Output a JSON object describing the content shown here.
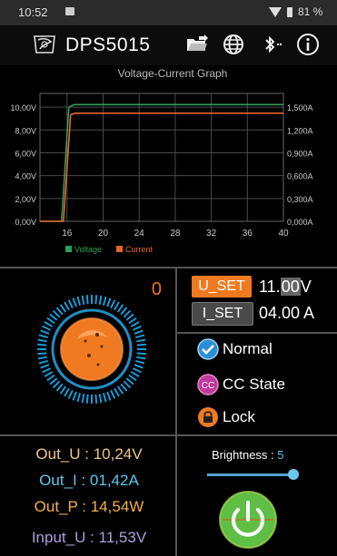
{
  "status_bar": {
    "time": "10:52",
    "battery": "81 %"
  },
  "app": {
    "title": "DPS5015"
  },
  "chart_data": {
    "type": "line",
    "title": "Voltage-Current Graph",
    "x_ticks": [
      "16",
      "20",
      "24",
      "28",
      "32",
      "36",
      "40"
    ],
    "x_range": [
      13,
      40
    ],
    "y_left_ticks": [
      "0,00V",
      "2,00V",
      "4,00V",
      "6,00V",
      "8,00V",
      "10,00V"
    ],
    "y_left_range": [
      0,
      11.2
    ],
    "y_right_ticks": [
      "0,000A",
      "0,300A",
      "0,600A",
      "0,900A",
      "1,200A",
      "1,500A"
    ],
    "y_right_range": [
      0,
      1.68
    ],
    "legend": [
      "Voltage",
      "Current"
    ],
    "legend_position": "bottom-left",
    "series": [
      {
        "name": "Voltage",
        "color": "#2e9e5b",
        "axis": "left",
        "x": [
          13,
          15.4,
          16.2,
          16.8,
          40
        ],
        "y": [
          0,
          0,
          10.0,
          10.22,
          10.22
        ]
      },
      {
        "name": "Current",
        "color": "#e8662a",
        "axis": "right",
        "x": [
          13,
          15.6,
          16.4,
          16.9,
          40
        ],
        "y": [
          0,
          0,
          1.4,
          1.42,
          1.42
        ]
      }
    ]
  },
  "knob": {
    "value": "0"
  },
  "set": {
    "u_label": "U_SET",
    "u_pre": "11.",
    "u_highlight": "00",
    "u_unit": "V",
    "i_label": "I_SET",
    "i_value": "04.00 A"
  },
  "states": {
    "normal": "Normal",
    "cc": "CC State",
    "cc_icon": "CC",
    "lock": "Lock"
  },
  "readouts": {
    "out_u": "Out_U : 10,24V",
    "out_i": "Out_I  : 01,42A",
    "out_p": "Out_P : 14,54W",
    "input_u": "Input_U : 11,53V"
  },
  "brightness": {
    "label": "Brightness : ",
    "value": "5",
    "level_fraction": 0.95
  },
  "colors": {
    "accent_orange": "#f07020",
    "u_set_bg": "#f07a20",
    "i_set_bg": "#4a4a4a",
    "out_u": "#f2c58a",
    "out_i": "#5cc8f0",
    "out_p": "#f5b04a",
    "input_u": "#b39ddb"
  }
}
